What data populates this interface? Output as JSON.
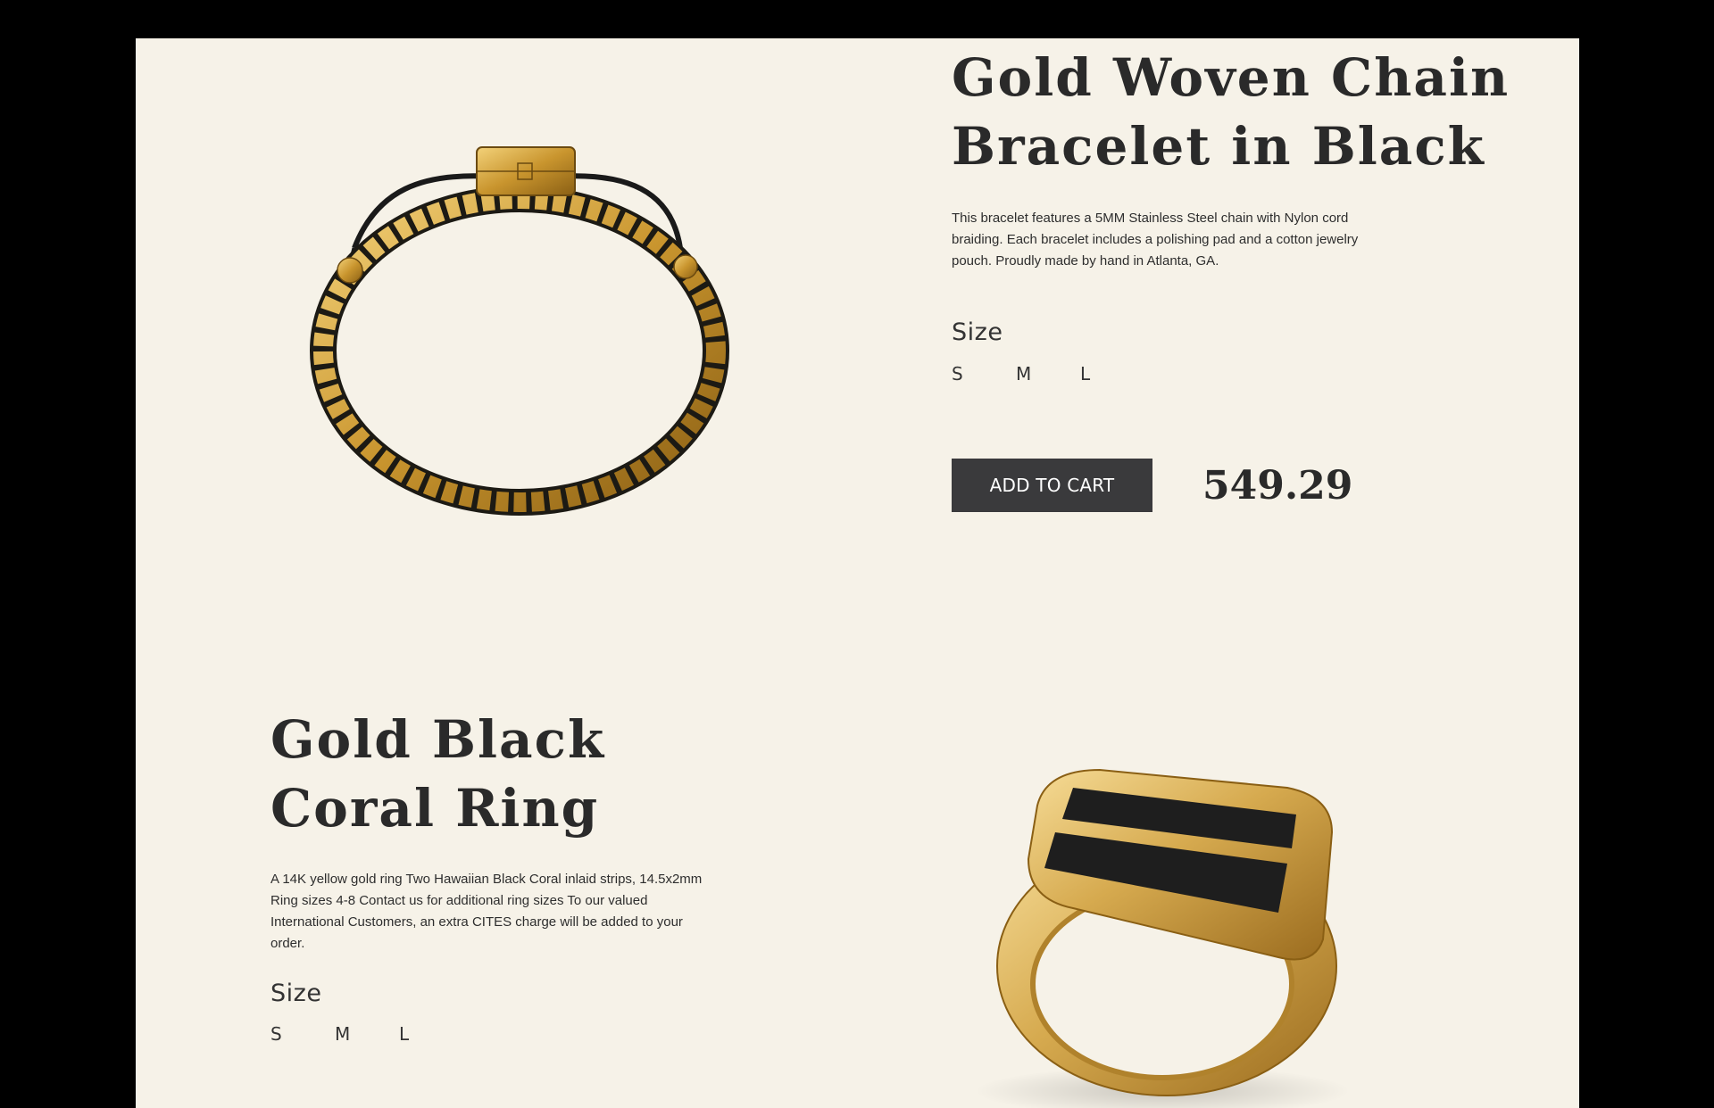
{
  "products": [
    {
      "title": "Gold Woven Chain Bracelet in Black",
      "description": "This bracelet features a 5MM Stainless Steel chain with Nylon cord braiding. Each bracelet includes a polishing pad and a cotton jewelry pouch. Proudly made by hand in Atlanta, GA.",
      "size_label": "Size",
      "sizes": [
        "S",
        "M",
        "L"
      ],
      "cart_label": "ADD TO CART",
      "price": "549.29"
    },
    {
      "title": "Gold Black Coral Ring",
      "description": "A 14K yellow gold ring Two Hawaiian Black Coral inlaid strips, 14.5x2mm Ring sizes 4-8 Contact us for additional ring sizes To our valued International Customers, an extra CITES charge will be added to your order.",
      "size_label": "Size",
      "sizes": [
        "S",
        "M",
        "L"
      ]
    }
  ],
  "colors": {
    "page_background": "#f6f2e8",
    "outer_background": "#000000",
    "text": "#2a2a2a",
    "button": "#3a3a3c",
    "gold": "#d4a84a"
  },
  "icons": [
    "bracelet-image",
    "ring-image"
  ]
}
